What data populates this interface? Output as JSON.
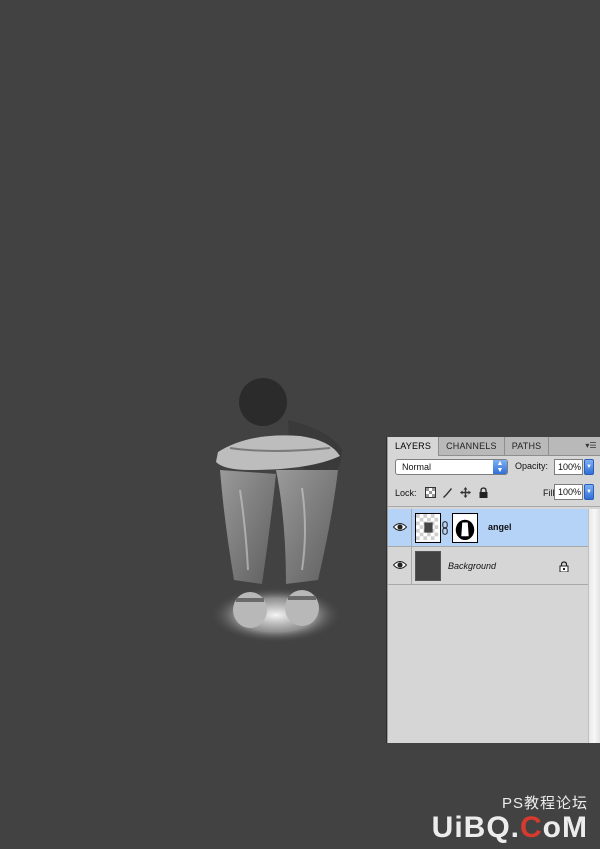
{
  "panel": {
    "tabs": [
      {
        "label": "LAYERS",
        "active": true
      },
      {
        "label": "CHANNELS",
        "active": false
      },
      {
        "label": "PATHS",
        "active": false
      }
    ],
    "menu_icon": "panel-menu-icon",
    "blend_mode": "Normal",
    "opacity_label": "Opacity:",
    "opacity_value": "100%",
    "lock_label": "Lock:",
    "fill_label": "Fill:",
    "fill_value": "100%",
    "lock_icons": [
      "lock-transparent-icon",
      "lock-image-icon",
      "lock-position-icon",
      "lock-all-icon"
    ]
  },
  "layers": [
    {
      "name": "angel",
      "selected": true,
      "visible": true,
      "has_mask": true
    },
    {
      "name": "Background",
      "selected": false,
      "visible": true,
      "locked": true
    }
  ],
  "watermark": {
    "line1": "PS教程论坛",
    "logo_a": "UiBQ.",
    "logo_b": "C",
    "logo_c": "oM"
  },
  "colors": {
    "canvas": "#424242",
    "panel": "#d6d6d6",
    "selected_layer": "#b5d2f7",
    "accent": "#2f6fd6"
  }
}
